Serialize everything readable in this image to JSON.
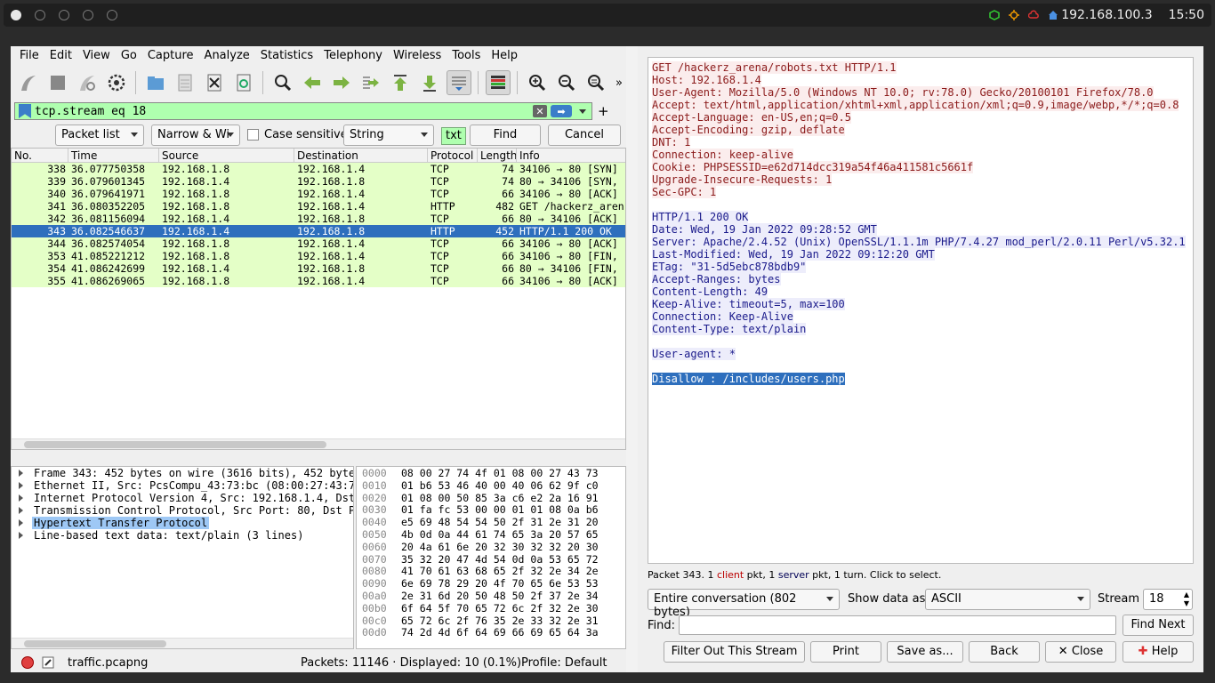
{
  "topbar": {
    "ip": "192.168.100.3",
    "time": "15:50"
  },
  "menu": [
    "File",
    "Edit",
    "View",
    "Go",
    "Capture",
    "Analyze",
    "Statistics",
    "Telephony",
    "Wireless",
    "Tools",
    "Help"
  ],
  "filter": {
    "text": "tcp.stream eq 18"
  },
  "findbar": {
    "scope": "Packet list",
    "charwidth": "Narrow & Wi",
    "case_label": "Case sensitive",
    "type": "String",
    "txt": "txt",
    "find": "Find",
    "cancel": "Cancel"
  },
  "columns": [
    "No.",
    "Time",
    "Source",
    "Destination",
    "Protocol",
    "Length",
    "Info"
  ],
  "packets": [
    {
      "no": "338",
      "time": "36.077750358",
      "src": "192.168.1.8",
      "dst": "192.168.1.4",
      "proto": "TCP",
      "len": "74",
      "info": "34106 → 80 [SYN]"
    },
    {
      "no": "339",
      "time": "36.079601345",
      "src": "192.168.1.4",
      "dst": "192.168.1.8",
      "proto": "TCP",
      "len": "74",
      "info": "80 → 34106 [SYN,"
    },
    {
      "no": "340",
      "time": "36.079641971",
      "src": "192.168.1.8",
      "dst": "192.168.1.4",
      "proto": "TCP",
      "len": "66",
      "info": "34106 → 80 [ACK]"
    },
    {
      "no": "341",
      "time": "36.080352205",
      "src": "192.168.1.8",
      "dst": "192.168.1.4",
      "proto": "HTTP",
      "len": "482",
      "info": "GET /hackerz_aren"
    },
    {
      "no": "342",
      "time": "36.081156094",
      "src": "192.168.1.4",
      "dst": "192.168.1.8",
      "proto": "TCP",
      "len": "66",
      "info": "80 → 34106 [ACK]"
    },
    {
      "no": "343",
      "time": "36.082546637",
      "src": "192.168.1.4",
      "dst": "192.168.1.8",
      "proto": "HTTP",
      "len": "452",
      "info": "HTTP/1.1 200 OK"
    },
    {
      "no": "344",
      "time": "36.082574054",
      "src": "192.168.1.8",
      "dst": "192.168.1.4",
      "proto": "TCP",
      "len": "66",
      "info": "34106 → 80 [ACK]"
    },
    {
      "no": "353",
      "time": "41.085221212",
      "src": "192.168.1.8",
      "dst": "192.168.1.4",
      "proto": "TCP",
      "len": "66",
      "info": "34106 → 80 [FIN,"
    },
    {
      "no": "354",
      "time": "41.086242699",
      "src": "192.168.1.4",
      "dst": "192.168.1.8",
      "proto": "TCP",
      "len": "66",
      "info": "80 → 34106 [FIN,"
    },
    {
      "no": "355",
      "time": "41.086269065",
      "src": "192.168.1.8",
      "dst": "192.168.1.4",
      "proto": "TCP",
      "len": "66",
      "info": "34106 → 80 [ACK]"
    }
  ],
  "details": [
    "Frame 343: 452 bytes on wire (3616 bits), 452 byte",
    "Ethernet II, Src: PcsCompu_43:73:bc (08:00:27:43:7",
    "Internet Protocol Version 4, Src: 192.168.1.4, Dst",
    "Transmission Control Protocol, Src Port: 80, Dst P",
    "Hypertext Transfer Protocol",
    "Line-based text data: text/plain (3 lines)"
  ],
  "bytes": [
    {
      "off": "0000",
      "hex": "08 00 27 74 4f 01 08 00  27 43 73"
    },
    {
      "off": "0010",
      "hex": "01 b6 53 46 40 00 40 06  62 9f c0"
    },
    {
      "off": "0020",
      "hex": "01 08 00 50 85 3a c6 e2  2a 16 91"
    },
    {
      "off": "0030",
      "hex": "01 fa fc 53 00 00 01 01  08 0a b6"
    },
    {
      "off": "0040",
      "hex": "e5 69 48 54 54 50 2f 31  2e 31 20"
    },
    {
      "off": "0050",
      "hex": "4b 0d 0a 44 61 74 65 3a  20 57 65"
    },
    {
      "off": "0060",
      "hex": "20 4a 61 6e 20 32 30 32  32 20 30"
    },
    {
      "off": "0070",
      "hex": "35 32 20 47 4d 54 0d 0a  53 65 72"
    },
    {
      "off": "0080",
      "hex": "41 70 61 63 68 65 2f 32  2e 34 2e"
    },
    {
      "off": "0090",
      "hex": "6e 69 78 29 20 4f 70 65  6e 53 53"
    },
    {
      "off": "00a0",
      "hex": "2e 31 6d 20 50 48 50 2f  37 2e 34"
    },
    {
      "off": "00b0",
      "hex": "6f 64 5f 70 65 72 6c 2f  32 2e 30"
    },
    {
      "off": "00c0",
      "hex": "65 72 6c 2f 76 35 2e 33  32 2e 31"
    },
    {
      "off": "00d0",
      "hex": "74 2d 4d 6f 64 69 66 69  65 64 3a"
    }
  ],
  "status": {
    "file": "traffic.pcapng",
    "packets": "Packets: 11146 · Displayed: 10 (0.1%)",
    "profile": "Profile: Default"
  },
  "stream": {
    "request": [
      "GET /hackerz_arena/robots.txt HTTP/1.1",
      "Host: 192.168.1.4",
      "User-Agent: Mozilla/5.0 (Windows NT 10.0; rv:78.0) Gecko/20100101 Firefox/78.0",
      "Accept: text/html,application/xhtml+xml,application/xml;q=0.9,image/webp,*/*;q=0.8",
      "Accept-Language: en-US,en;q=0.5",
      "Accept-Encoding: gzip, deflate",
      "DNT: 1",
      "Connection: keep-alive",
      "Cookie: PHPSESSID=e62d714dcc319a54f46a411581c5661f",
      "Upgrade-Insecure-Requests: 1",
      "Sec-GPC: 1"
    ],
    "response": [
      "HTTP/1.1 200 OK",
      "Date: Wed, 19 Jan 2022 09:28:52 GMT",
      "Server: Apache/2.4.52 (Unix) OpenSSL/1.1.1m PHP/7.4.27 mod_perl/2.0.11 Perl/v5.32.1",
      "Last-Modified: Wed, 19 Jan 2022 09:12:20 GMT",
      "ETag: \"31-5d5ebc878bdb9\"",
      "Accept-Ranges: bytes",
      "Content-Length: 49",
      "Keep-Alive: timeout=5, max=100",
      "Connection: Keep-Alive",
      "Content-Type: text/plain"
    ],
    "body_line1": "User-agent: *",
    "body_line2": "Disallow : /includes/users.php",
    "status_pre": "Packet 343. 1 ",
    "status_client": "client",
    "status_mid": " pkt, 1 ",
    "status_server": "server",
    "status_post": " pkt, 1 turn. Click to select.",
    "conversation": "Entire conversation (802 bytes)",
    "show_as_label": "Show data as",
    "show_as": "ASCII",
    "stream_label": "Stream",
    "stream_no": "18",
    "find_label": "Find:",
    "find_next": "Find Next",
    "buttons": {
      "filter_out": "Filter Out This Stream",
      "print": "Print",
      "save": "Save as...",
      "back": "Back",
      "close": "Close",
      "help": "Help"
    }
  }
}
